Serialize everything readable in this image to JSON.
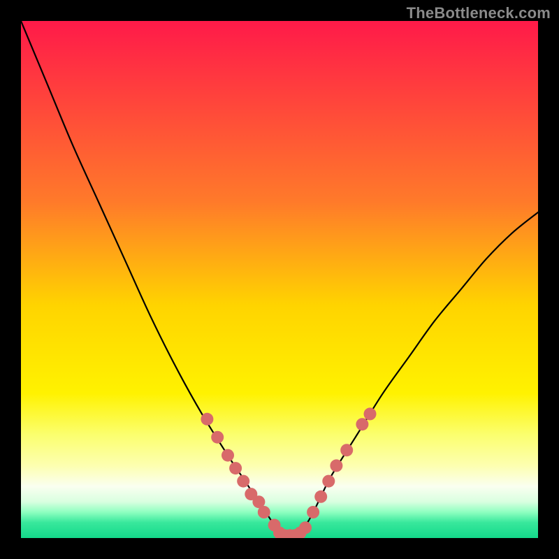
{
  "watermark": "TheBottleneck.com",
  "chart_data": {
    "type": "line",
    "title": "",
    "xlabel": "",
    "ylabel": "",
    "xlim": [
      0,
      100
    ],
    "ylim": [
      0,
      100
    ],
    "x": [
      0,
      5,
      10,
      15,
      20,
      25,
      30,
      35,
      40,
      42,
      44,
      46,
      48,
      50,
      52,
      54,
      56,
      58,
      60,
      65,
      70,
      75,
      80,
      85,
      90,
      95,
      100
    ],
    "values": [
      100,
      88,
      76,
      65,
      54,
      43,
      33,
      24,
      16,
      13,
      10,
      7,
      4,
      1,
      0,
      1,
      4,
      8,
      12,
      20,
      28,
      35,
      42,
      48,
      54,
      59,
      63
    ],
    "markers": [
      {
        "x": 36,
        "y": 23
      },
      {
        "x": 38,
        "y": 19.5
      },
      {
        "x": 40,
        "y": 16
      },
      {
        "x": 41.5,
        "y": 13.5
      },
      {
        "x": 43,
        "y": 11
      },
      {
        "x": 44.5,
        "y": 8.5
      },
      {
        "x": 46,
        "y": 7
      },
      {
        "x": 47,
        "y": 5
      },
      {
        "x": 49,
        "y": 2.5
      },
      {
        "x": 50,
        "y": 1
      },
      {
        "x": 51,
        "y": 0.5
      },
      {
        "x": 52,
        "y": 0.5
      },
      {
        "x": 53,
        "y": 0.5
      },
      {
        "x": 54,
        "y": 1
      },
      {
        "x": 55,
        "y": 2
      },
      {
        "x": 56.5,
        "y": 5
      },
      {
        "x": 58,
        "y": 8
      },
      {
        "x": 59.5,
        "y": 11
      },
      {
        "x": 61,
        "y": 14
      },
      {
        "x": 63,
        "y": 17
      },
      {
        "x": 66,
        "y": 22
      },
      {
        "x": 67.5,
        "y": 24
      }
    ],
    "gradient_stops": [
      {
        "offset": 0,
        "color": "#ff1a49"
      },
      {
        "offset": 35,
        "color": "#ff7a2a"
      },
      {
        "offset": 55,
        "color": "#ffd400"
      },
      {
        "offset": 72,
        "color": "#fff200"
      },
      {
        "offset": 80,
        "color": "#fbff6e"
      },
      {
        "offset": 86,
        "color": "#fdffb0"
      },
      {
        "offset": 90,
        "color": "#fafff0"
      },
      {
        "offset": 93,
        "color": "#d9ffe0"
      },
      {
        "offset": 95,
        "color": "#8effc0"
      },
      {
        "offset": 97,
        "color": "#38e89c"
      },
      {
        "offset": 100,
        "color": "#14d88a"
      }
    ],
    "marker_color": "#d86a6a",
    "line_color": "#000000"
  }
}
